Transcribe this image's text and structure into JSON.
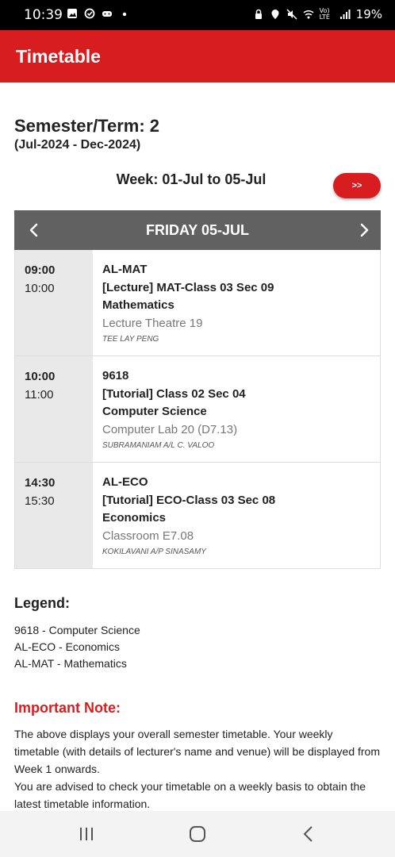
{
  "status_bar": {
    "time": "10:39",
    "battery": "19%",
    "network": "Vo) LTE"
  },
  "app_bar": {
    "title": "Timetable"
  },
  "semester": {
    "title": "Semester/Term: 2",
    "period": "(Jul-2024 - Dec-2024)"
  },
  "week": {
    "label": "Week: 01-Jul to 05-Jul",
    "next_label": ">>"
  },
  "day": {
    "label": "FRIDAY 05-JUL"
  },
  "sessions": [
    {
      "start": "09:00",
      "end": "10:00",
      "code": "AL-MAT",
      "class": "[Lecture] MAT-Class 03 Sec 09",
      "subject": "Mathematics",
      "venue": "Lecture Theatre 19",
      "lecturer": "TEE LAY PENG"
    },
    {
      "start": "10:00",
      "end": "11:00",
      "code": "9618",
      "class": "[Tutorial] Class 02 Sec 04",
      "subject": "Computer Science",
      "venue": "Computer Lab 20 (D7.13)",
      "lecturer": "SUBRAMANIAM A/L C. VALOO"
    },
    {
      "start": "14:30",
      "end": "15:30",
      "code": "AL-ECO",
      "class": "[Tutorial] ECO-Class 03 Sec 08",
      "subject": "Economics",
      "venue": "Classroom E7.08",
      "lecturer": "KOKILAVANI A/P SINASAMY"
    }
  ],
  "legend": {
    "title": "Legend:",
    "items": [
      "9618 - Computer Science",
      "AL-ECO - Economics",
      "AL-MAT - Mathematics"
    ]
  },
  "note": {
    "title": "Important Note:",
    "paragraph1": "The above displays your overall semester timetable. Your weekly timetable (with details of lecturer's name and venue) will be displayed from Week 1 onwards.",
    "paragraph2": "You are advised to check your timetable on a weekly basis to obtain the latest timetable information."
  },
  "colors": {
    "brand_red": "#d71d20",
    "day_header": "#616161",
    "time_column": "#e9e9e9"
  },
  "icons": [
    "gallery-icon",
    "sync-icon",
    "game-icon",
    "lock-icon",
    "location-icon",
    "mute-icon",
    "wifi-icon",
    "signal-icon",
    "chevron-left-icon",
    "chevron-right-icon",
    "recent-apps-icon",
    "home-icon",
    "back-icon"
  ]
}
